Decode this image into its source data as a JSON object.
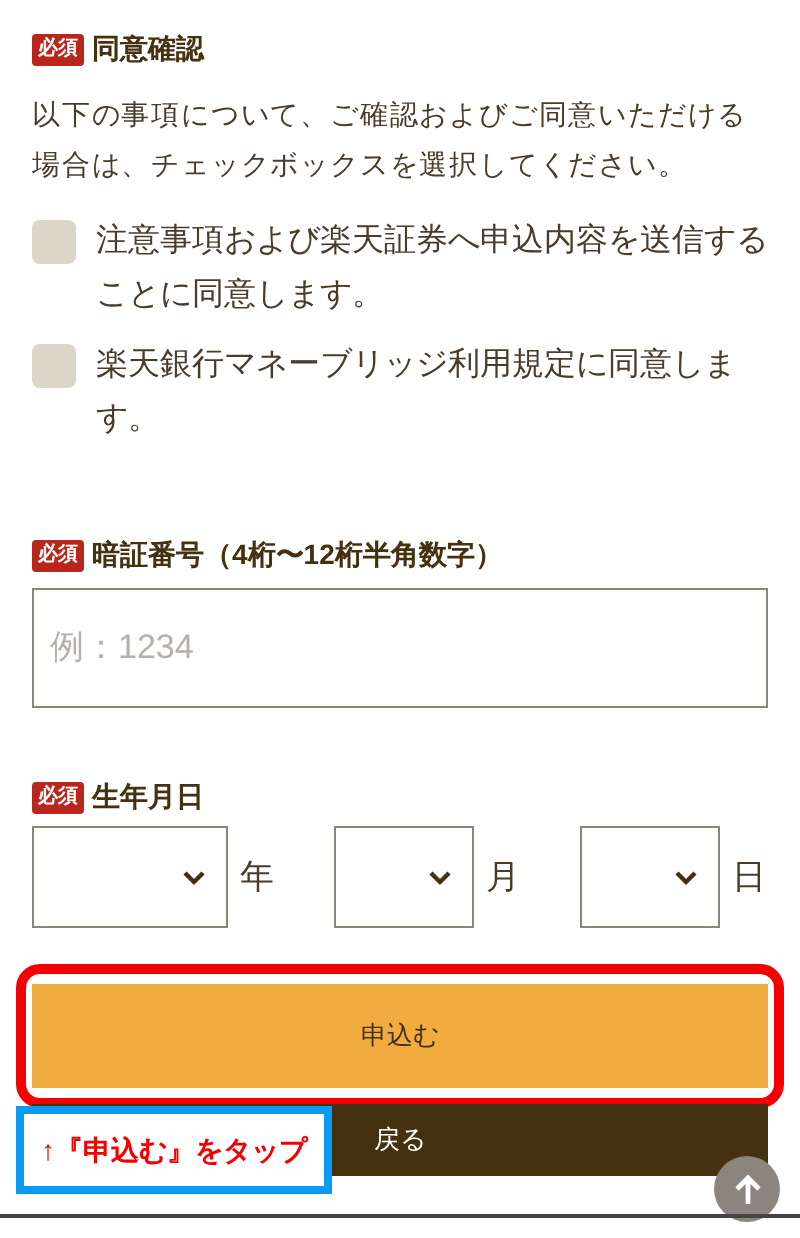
{
  "consent": {
    "badge": "必須",
    "title": "同意確認",
    "description": "以下の事項について、ご確認およびご同意いただける場合は、チェックボックスを選択してください。",
    "items": [
      {
        "label": "注意事項および楽天証券へ申込内容を送信することに同意します。",
        "checked": false
      },
      {
        "label": "楽天銀行マネーブリッジ利用規定に同意します。",
        "checked": false
      }
    ]
  },
  "pin": {
    "badge": "必須",
    "title": "暗証番号（4桁〜12桁半角数字）",
    "placeholder": "例：1234"
  },
  "birthdate": {
    "badge": "必須",
    "title": "生年月日",
    "fields": [
      {
        "unit": "年"
      },
      {
        "unit": "月"
      },
      {
        "unit": "日"
      }
    ]
  },
  "buttons": [
    {
      "label": "申込む",
      "kind": "primary",
      "highlighted": true
    },
    {
      "label": "戻る",
      "kind": "secondary",
      "highlighted": false
    }
  ],
  "annotation": "↑『申込む』をタップ"
}
